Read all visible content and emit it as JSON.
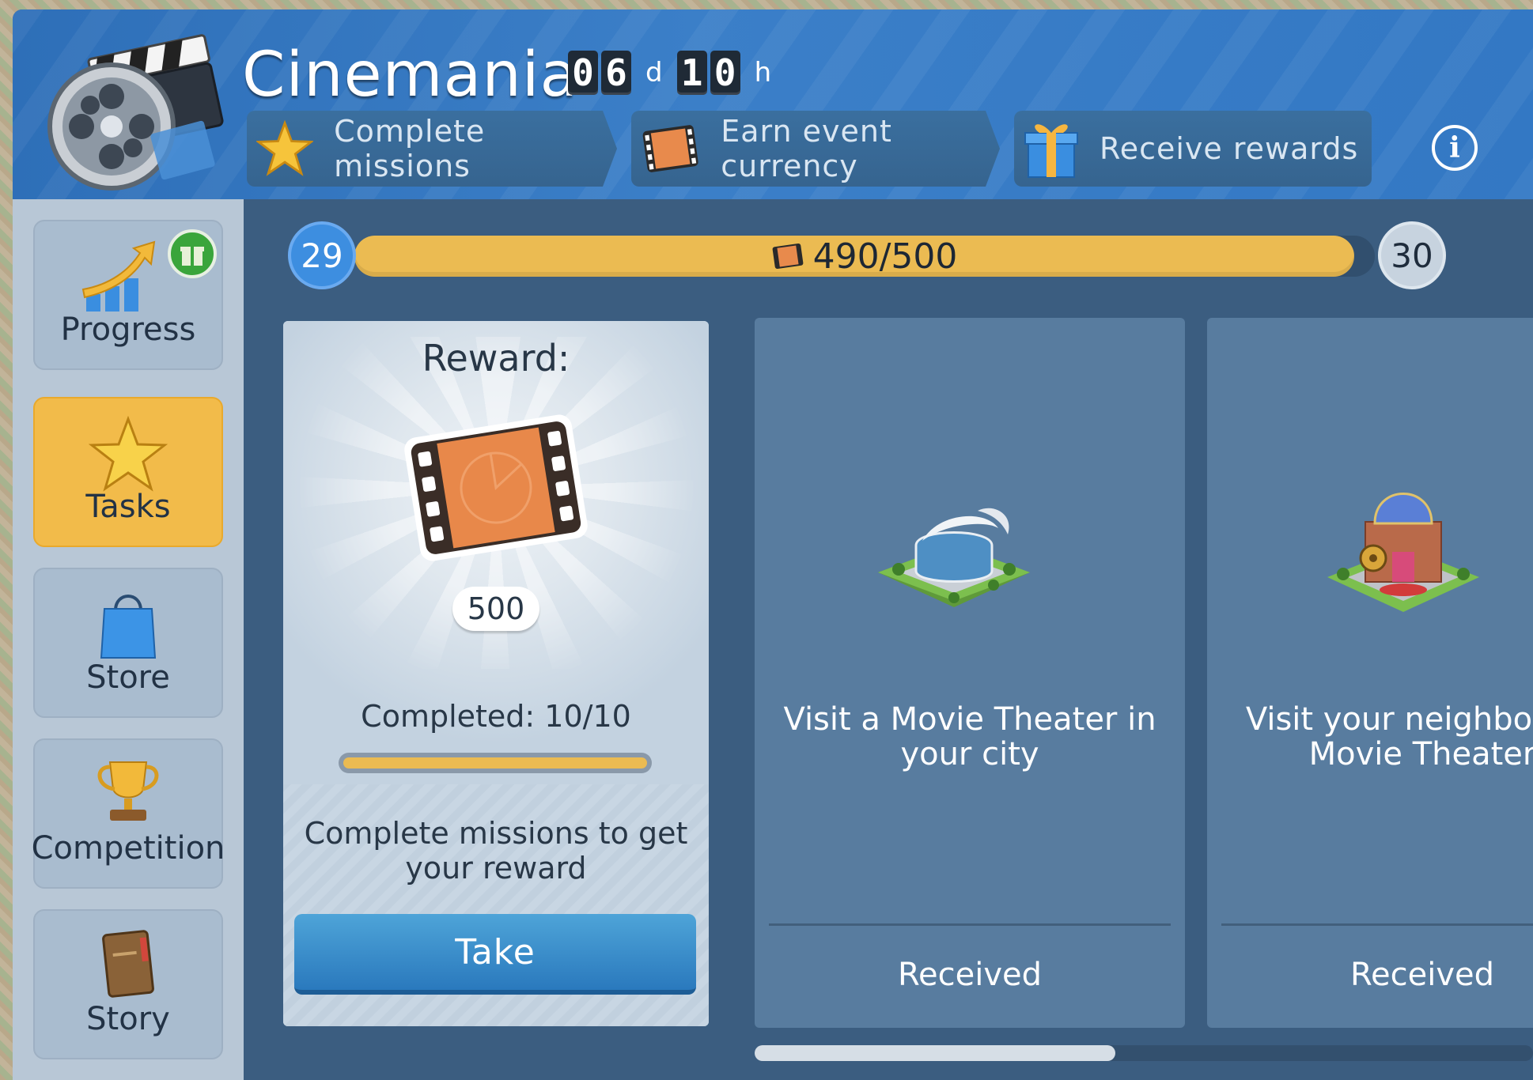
{
  "header": {
    "title": "Cinemania",
    "timer": {
      "days_d1": "0",
      "days_d2": "6",
      "days_unit": "d",
      "hours_d1": "1",
      "hours_d2": "0",
      "hours_unit": "h"
    },
    "steps": [
      "Complete missions",
      "Earn event currency",
      "Receive rewards"
    ],
    "info_icon": "info-icon"
  },
  "sidebar": {
    "items": [
      {
        "label": "Progress",
        "icon": "chart-arrow-icon",
        "badge_icon": "gift-icon",
        "active": false
      },
      {
        "label": "Tasks",
        "icon": "star-icon",
        "active": true
      },
      {
        "label": "Store",
        "icon": "shopping-bag-icon",
        "active": false
      },
      {
        "label": "Competition",
        "icon": "trophy-icon",
        "active": false
      },
      {
        "label": "Story",
        "icon": "book-icon",
        "active": false
      }
    ]
  },
  "progress": {
    "current_level": "29",
    "next_level": "30",
    "text": "490/500",
    "fraction": 0.98,
    "currency_icon": "film-ticket-icon"
  },
  "reward_card": {
    "title": "Reward:",
    "amount": "500",
    "completed": "Completed: 10/10",
    "completed_fraction": 1.0,
    "description": "Complete missions to get your reward",
    "button": "Take"
  },
  "tasks": [
    {
      "text": "Visit a Movie Theater in\nyour city",
      "line1": "Visit a Movie Theater in",
      "line2": "your city",
      "status": "Received",
      "image": "movie-theater-building-icon"
    },
    {
      "line1": "Visit your neighbor's F",
      "line2": "Movie Theater",
      "status": "Received",
      "image": "neighbor-movie-theater-building-icon"
    }
  ],
  "colors": {
    "accent": "#ebbb52",
    "primary_blue": "#2e6fb8",
    "button_blue": "#3a8ccb",
    "panel": "#587c9f"
  }
}
